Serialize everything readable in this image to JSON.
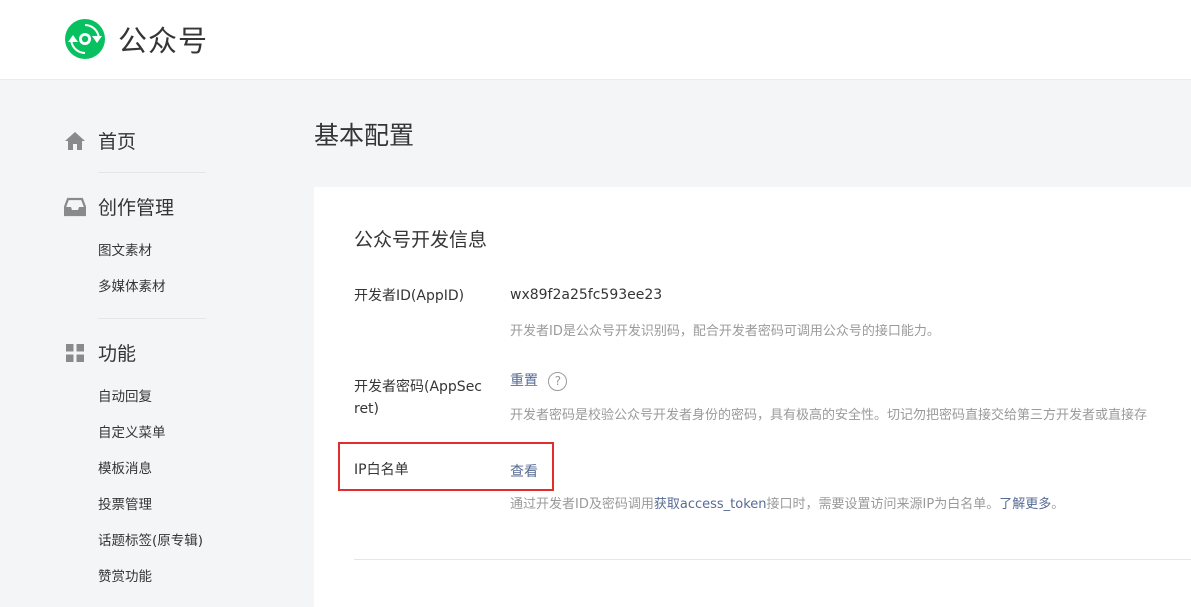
{
  "header": {
    "brand_name": "公众号",
    "brand_color": "#07c160"
  },
  "sidebar": {
    "home": {
      "label": "首页",
      "icon": "home-icon"
    },
    "creation": {
      "label": "创作管理",
      "icon": "inbox-icon",
      "items": [
        "图文素材",
        "多媒体素材"
      ]
    },
    "features": {
      "label": "功能",
      "icon": "grid-icon",
      "items": [
        "自动回复",
        "自定义菜单",
        "模板消息",
        "投票管理",
        "话题标签(原专辑)",
        "赞赏功能"
      ]
    }
  },
  "main": {
    "page_title": "基本配置",
    "card_title": "公众号开发信息",
    "appid": {
      "label": "开发者ID(AppID)",
      "value": "wx89f2a25fc593ee23",
      "desc": "开发者ID是公众号开发识别码，配合开发者密码可调用公众号的接口能力。"
    },
    "appsecret": {
      "label": "开发者密码(AppSecret)",
      "action": "重置",
      "help": "?",
      "desc": "开发者密码是校验公众号开发者身份的密码，具有极高的安全性。切记勿把密码直接交给第三方开发者或直接存"
    },
    "ip_whitelist": {
      "label": "IP白名单",
      "action": "查看",
      "desc_prefix": "通过开发者ID及密码调用",
      "desc_link1": "获取access_token",
      "desc_middle": "接口时，需要设置访问来源IP为白名单。",
      "desc_link2": "了解更多",
      "desc_suffix": "。"
    }
  },
  "colors": {
    "link": "#576b95",
    "highlight": "#e02e2e"
  }
}
